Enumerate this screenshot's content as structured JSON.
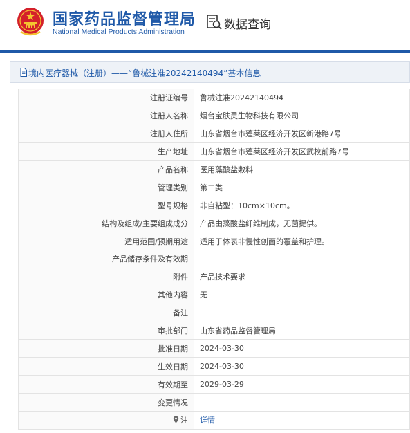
{
  "header": {
    "agency_cn": "国家药品监督管理局",
    "agency_en": "National Medical Products Administration",
    "query_label": "数据查询",
    "brand_color": "#1f59a8"
  },
  "panel": {
    "title": "境内医疗器械（注册）——“鲁械注准20242140494”基本信息"
  },
  "rows": [
    {
      "label": "注册证编号",
      "value": "鲁械注准20242140494"
    },
    {
      "label": "注册人名称",
      "value": "烟台宝肤灵生物科技有限公司"
    },
    {
      "label": "注册人住所",
      "value": "山东省烟台市蓬莱区经济开发区新港路7号"
    },
    {
      "label": "生产地址",
      "value": "山东省烟台市蓬莱区经济开发区武校前路7号"
    },
    {
      "label": "产品名称",
      "value": "医用藻酸盐敷料"
    },
    {
      "label": "管理类别",
      "value": "第二类"
    },
    {
      "label": "型号规格",
      "value": "非自粘型：10cm×10cm。"
    },
    {
      "label": "结构及组成/主要组成成分",
      "value": "产品由藻酸盐纤维制成，无菌提供。"
    },
    {
      "label": "适用范围/预期用途",
      "value": "适用于体表非慢性创面的覆盖和护理。"
    },
    {
      "label": "产品储存条件及有效期",
      "value": ""
    },
    {
      "label": "附件",
      "value": "产品技术要求"
    },
    {
      "label": "其他内容",
      "value": "无"
    },
    {
      "label": "备注",
      "value": ""
    },
    {
      "label": "审批部门",
      "value": "山东省药品监督管理局"
    },
    {
      "label": "批准日期",
      "value": "2024-03-30"
    },
    {
      "label": "生效日期",
      "value": "2024-03-30"
    },
    {
      "label": "有效期至",
      "value": "2029-03-29"
    },
    {
      "label": "变更情况",
      "value": ""
    },
    {
      "label": "注",
      "value": "详情",
      "icon": "location-pin-icon",
      "link": true
    }
  ]
}
